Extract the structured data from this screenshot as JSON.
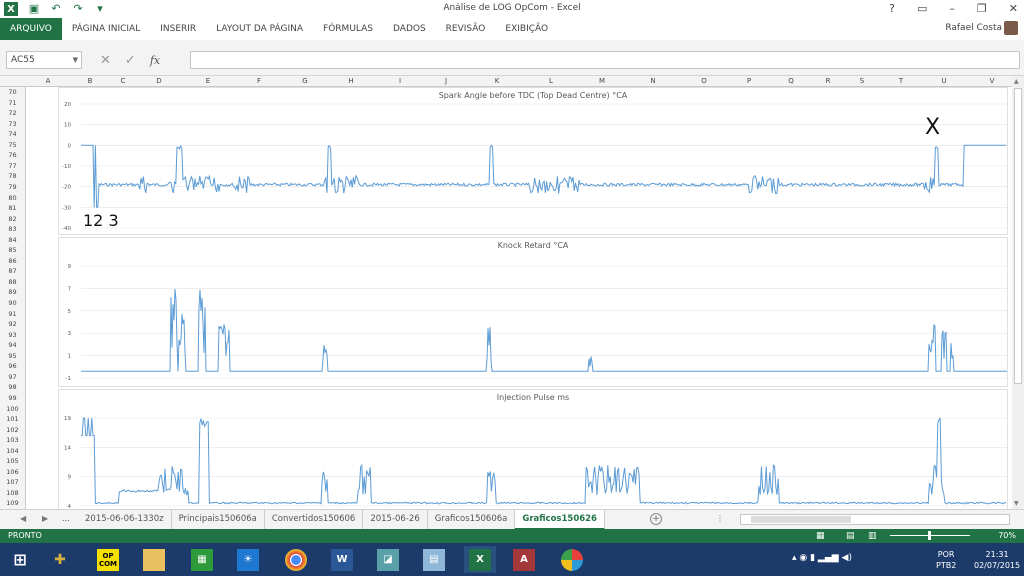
{
  "window": {
    "title": "Análise de LOG OpCom - Excel",
    "user": "Rafael Costa"
  },
  "ribbon_tabs": [
    "ARQUIVO",
    "PÁGINA INICIAL",
    "INSERIR",
    "LAYOUT DA PÁGINA",
    "FÓRMULAS",
    "DADOS",
    "REVISÃO",
    "EXIBIÇÃO"
  ],
  "formula_bar": {
    "name_box": "AC55",
    "fx_label": "fx",
    "formula": ""
  },
  "columns": [
    "A",
    "B",
    "C",
    "D",
    "E",
    "F",
    "G",
    "H",
    "I",
    "J",
    "K",
    "L",
    "M",
    "N",
    "O",
    "P",
    "Q",
    "R",
    "S",
    "T",
    "U",
    "V"
  ],
  "rows": [
    "70",
    "71",
    "72",
    "73",
    "74",
    "75",
    "76",
    "77",
    "78",
    "79",
    "80",
    "81",
    "82",
    "83",
    "84",
    "85",
    "86",
    "87",
    "88",
    "89",
    "90",
    "91",
    "92",
    "93",
    "94",
    "95",
    "96",
    "97",
    "98",
    "99",
    "100",
    "101",
    "102",
    "103",
    "104",
    "105",
    "106",
    "107",
    "108",
    "109"
  ],
  "charts": [
    {
      "title": "Spark Angle before TDC (Top Dead Centre) °CA",
      "yticks": [
        "20",
        "10",
        "0",
        "-10",
        "-20",
        "-30",
        "-40"
      ]
    },
    {
      "title": "Knock Retard °CA",
      "yticks": [
        "9",
        "7",
        "5",
        "3",
        "1",
        "-1"
      ]
    },
    {
      "title": "Injection Pulse ms",
      "yticks": [
        "19",
        "14",
        "9",
        "4"
      ]
    }
  ],
  "annotations": {
    "chart1_left": "12 3",
    "chart1_right": "X"
  },
  "sheet_tabs": {
    "ellipsis": "...",
    "items": [
      "2015-06-06-1330z",
      "Principais150606a",
      "Convertidos150606",
      "2015-06-26",
      "Graficos150606a",
      "Graficos150626"
    ],
    "active": "Graficos150626"
  },
  "status": {
    "text": "PRONTO",
    "zoom": "70%"
  },
  "taskbar": {
    "lang": "POR",
    "kbd": "PTB2",
    "time": "21:31",
    "date": "02/07/2015",
    "opcom_label": "OP COM"
  },
  "colors": {
    "excel_green": "#217346",
    "series": "#5b9bd5",
    "taskbar": "#1c3b6a"
  }
}
